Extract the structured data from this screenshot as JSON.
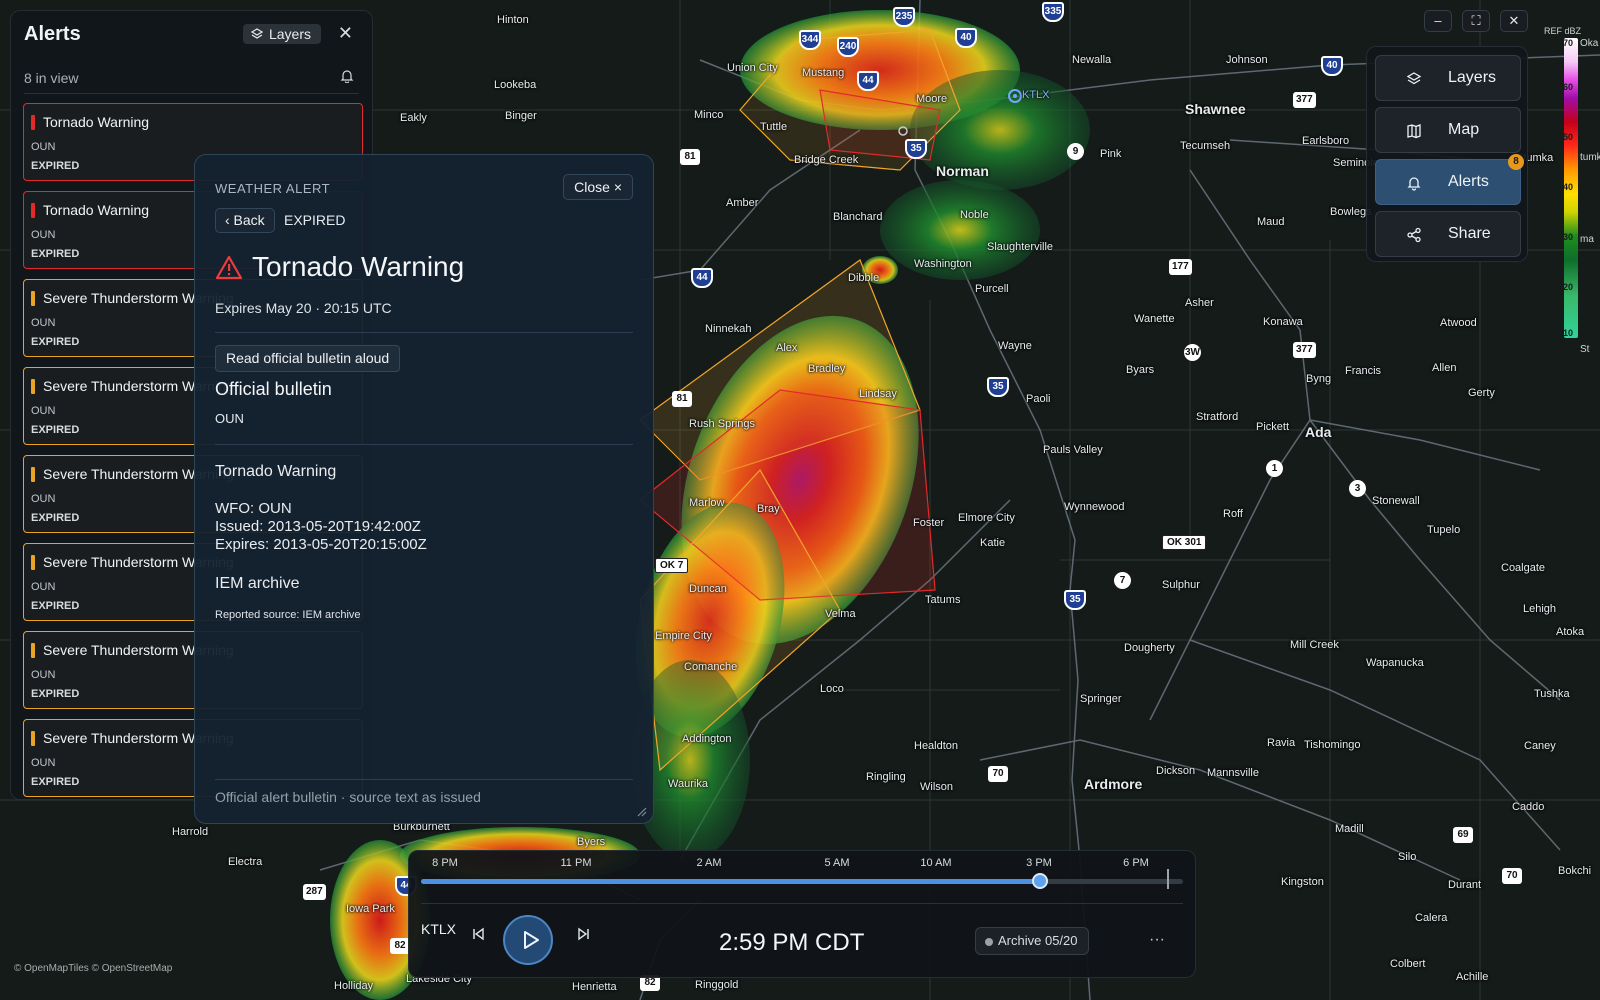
{
  "map": {
    "attribution": "© OpenMapTiles © OpenStreetMap",
    "cities": [
      {
        "name": "Hinton"
      },
      {
        "name": "Union City"
      },
      {
        "name": "Mustang"
      },
      {
        "name": "Moore"
      },
      {
        "name": "Newalla"
      },
      {
        "name": "Johnson"
      },
      {
        "name": "Lookeba"
      },
      {
        "name": "Minco"
      },
      {
        "name": "Tuttle"
      },
      {
        "name": "Eakly"
      },
      {
        "name": "Binger"
      },
      {
        "name": "Bridge Creek"
      },
      {
        "name": "Norman",
        "big": true
      },
      {
        "name": "Shawnee",
        "big": true
      },
      {
        "name": "Tecumseh"
      },
      {
        "name": "Earlsboro"
      },
      {
        "name": "Seminole"
      },
      {
        "name": "Pink"
      },
      {
        "name": "Amber"
      },
      {
        "name": "Blanchard"
      },
      {
        "name": "Noble"
      },
      {
        "name": "Slaughterville"
      },
      {
        "name": "Maud"
      },
      {
        "name": "Bowlegs"
      },
      {
        "name": "Washington"
      },
      {
        "name": "Purcell"
      },
      {
        "name": "Dibble"
      },
      {
        "name": "Asher"
      },
      {
        "name": "Wanette"
      },
      {
        "name": "Konawa"
      },
      {
        "name": "Atwood"
      },
      {
        "name": "Ninnekah"
      },
      {
        "name": "Alex"
      },
      {
        "name": "Bradley"
      },
      {
        "name": "Wayne"
      },
      {
        "name": "Byars"
      },
      {
        "name": "Byng"
      },
      {
        "name": "Francis"
      },
      {
        "name": "Allen"
      },
      {
        "name": "Lindsay"
      },
      {
        "name": "Paoli"
      },
      {
        "name": "Gerty"
      },
      {
        "name": "Rush Springs"
      },
      {
        "name": "Stratford"
      },
      {
        "name": "Pickett"
      },
      {
        "name": "Ada",
        "big": true
      },
      {
        "name": "Pauls Valley"
      },
      {
        "name": "Marlow"
      },
      {
        "name": "Bray"
      },
      {
        "name": "Wynnewood"
      },
      {
        "name": "Roff"
      },
      {
        "name": "Stonewall"
      },
      {
        "name": "Foster"
      },
      {
        "name": "Elmore City"
      },
      {
        "name": "Tupelo"
      },
      {
        "name": "Katie"
      },
      {
        "name": "Duncan"
      },
      {
        "name": "Sulphur"
      },
      {
        "name": "Coalgate"
      },
      {
        "name": "Tatums"
      },
      {
        "name": "Velma"
      },
      {
        "name": "Lehigh"
      },
      {
        "name": "Empire City"
      },
      {
        "name": "Dougherty"
      },
      {
        "name": "Mill Creek"
      },
      {
        "name": "Comanche"
      },
      {
        "name": "Wapanucka"
      },
      {
        "name": "Loco"
      },
      {
        "name": "Springer"
      },
      {
        "name": "Tushka"
      },
      {
        "name": "Addington"
      },
      {
        "name": "Healdton"
      },
      {
        "name": "Ravia"
      },
      {
        "name": "Tishomingo"
      },
      {
        "name": "Caney"
      },
      {
        "name": "Ringling"
      },
      {
        "name": "Waurika"
      },
      {
        "name": "Wilson"
      },
      {
        "name": "Ardmore",
        "big": true
      },
      {
        "name": "Dickson"
      },
      {
        "name": "Mannsville"
      },
      {
        "name": "Caddo"
      },
      {
        "name": "Madill"
      },
      {
        "name": "Harrold"
      },
      {
        "name": "Electra"
      },
      {
        "name": "Burkburnett"
      },
      {
        "name": "Byers"
      },
      {
        "name": "Silo"
      },
      {
        "name": "Iowa Park"
      },
      {
        "name": "Kingston"
      },
      {
        "name": "Durant"
      },
      {
        "name": "Calera"
      },
      {
        "name": "Lakeside City"
      },
      {
        "name": "Henrietta"
      },
      {
        "name": "Ringgold"
      },
      {
        "name": "Colbert"
      },
      {
        "name": "Achille"
      },
      {
        "name": "Holliday"
      },
      {
        "name": "Bokchi"
      },
      {
        "name": "Atoka"
      },
      {
        "name": "Stumka"
      }
    ],
    "shields": [
      {
        "t": "interstate",
        "n": "344"
      },
      {
        "t": "interstate",
        "n": "240"
      },
      {
        "t": "interstate",
        "n": "235"
      },
      {
        "t": "interstate",
        "n": "40"
      },
      {
        "t": "interstate",
        "n": "335"
      },
      {
        "t": "interstate",
        "n": "44"
      },
      {
        "t": "interstate",
        "n": "35"
      },
      {
        "t": "interstate",
        "n": "40"
      },
      {
        "t": "us",
        "n": "81"
      },
      {
        "t": "state",
        "n": "9"
      },
      {
        "t": "us",
        "n": "377"
      },
      {
        "t": "interstate",
        "n": "44"
      },
      {
        "t": "us",
        "n": "177"
      },
      {
        "t": "us",
        "n": "81"
      },
      {
        "t": "state",
        "n": "3W"
      },
      {
        "t": "us",
        "n": "377"
      },
      {
        "t": "interstate",
        "n": "35"
      },
      {
        "t": "state",
        "n": "1"
      },
      {
        "t": "state",
        "n": "3"
      },
      {
        "t": "ok",
        "n": "OK 301"
      },
      {
        "t": "ok",
        "n": "OK 7"
      },
      {
        "t": "state",
        "n": "7"
      },
      {
        "t": "interstate",
        "n": "35"
      },
      {
        "t": "us",
        "n": "70"
      },
      {
        "t": "us",
        "n": "287"
      },
      {
        "t": "us",
        "n": "69"
      },
      {
        "t": "us",
        "n": "70"
      },
      {
        "t": "us",
        "n": "82"
      },
      {
        "t": "us",
        "n": "82"
      },
      {
        "t": "interstate",
        "n": "44"
      }
    ],
    "radar_site": "KTLX"
  },
  "alerts_panel": {
    "title": "Alerts",
    "layers_label": "Layers",
    "count_text": "8 in view",
    "items": [
      {
        "name": "Tornado Warning",
        "wfo": "OUN",
        "status": "EXPIRED",
        "kind": "tornado"
      },
      {
        "name": "Tornado Warning",
        "wfo": "OUN",
        "status": "EXPIRED",
        "kind": "tornado"
      },
      {
        "name": "Severe Thunderstorm Warning",
        "wfo": "OUN",
        "status": "EXPIRED",
        "kind": "severe"
      },
      {
        "name": "Severe Thunderstorm Warning",
        "wfo": "OUN",
        "status": "EXPIRED",
        "kind": "severe"
      },
      {
        "name": "Severe Thunderstorm Warning",
        "wfo": "OUN",
        "status": "EXPIRED",
        "kind": "severe"
      },
      {
        "name": "Severe Thunderstorm Warning",
        "wfo": "OUN",
        "status": "EXPIRED",
        "kind": "severe"
      },
      {
        "name": "Severe Thunderstorm Warning",
        "wfo": "OUN",
        "status": "EXPIRED",
        "kind": "severe"
      },
      {
        "name": "Severe Thunderstorm Warning",
        "wfo": "OUN",
        "status": "EXPIRED",
        "kind": "severe"
      }
    ]
  },
  "detail": {
    "kicker": "WEATHER ALERT",
    "close_label": "Close ×",
    "back_label": "‹ Back",
    "status": "EXPIRED",
    "title": "Tornado Warning",
    "expires": "Expires May 20 · 20:15 UTC",
    "read_aloud": "Read official bulletin aloud",
    "bulletin_heading": "Official bulletin",
    "bulletin_office": "OUN",
    "bulletin_title": "Tornado Warning",
    "bulletin_lines": [
      "WFO: OUN",
      "Issued: 2013-05-20T19:42:00Z",
      "Expires: 2013-05-20T20:15:00Z"
    ],
    "archive_heading": "IEM archive",
    "reported_source": "Reported source: IEM archive",
    "footer": "Official alert bulletin · source text as issued"
  },
  "right_panel": {
    "buttons": [
      {
        "label": "Layers",
        "icon": "layers-icon"
      },
      {
        "label": "Map",
        "icon": "map-icon"
      },
      {
        "label": "Alerts",
        "icon": "bell-icon",
        "active": true,
        "badge": "8"
      },
      {
        "label": "Share",
        "icon": "share-icon"
      }
    ]
  },
  "window_controls": {
    "minimize": "–",
    "fullscreen": "⛶",
    "close": "✕"
  },
  "legend": {
    "title": "REF dBZ",
    "ticks": [
      "70",
      "60",
      "50",
      "40",
      "30",
      "20",
      "10"
    ],
    "side_labels": [
      "Oka",
      "tumka",
      "ma",
      "St"
    ]
  },
  "timeline": {
    "labels": [
      "8 PM",
      "11 PM",
      "2 AM",
      "5 AM",
      "10 AM",
      "3 PM",
      "6 PM"
    ],
    "progress": 0.81,
    "station": "KTLX",
    "time": "2:59 PM CDT",
    "archive": "Archive 05/20",
    "more": "···"
  },
  "colors": {
    "tornado": "#e22a2a",
    "severe": "#e8a425",
    "accent": "#4d8fe0",
    "active_button": "#2d4f72",
    "badge": "#e59a1e"
  }
}
